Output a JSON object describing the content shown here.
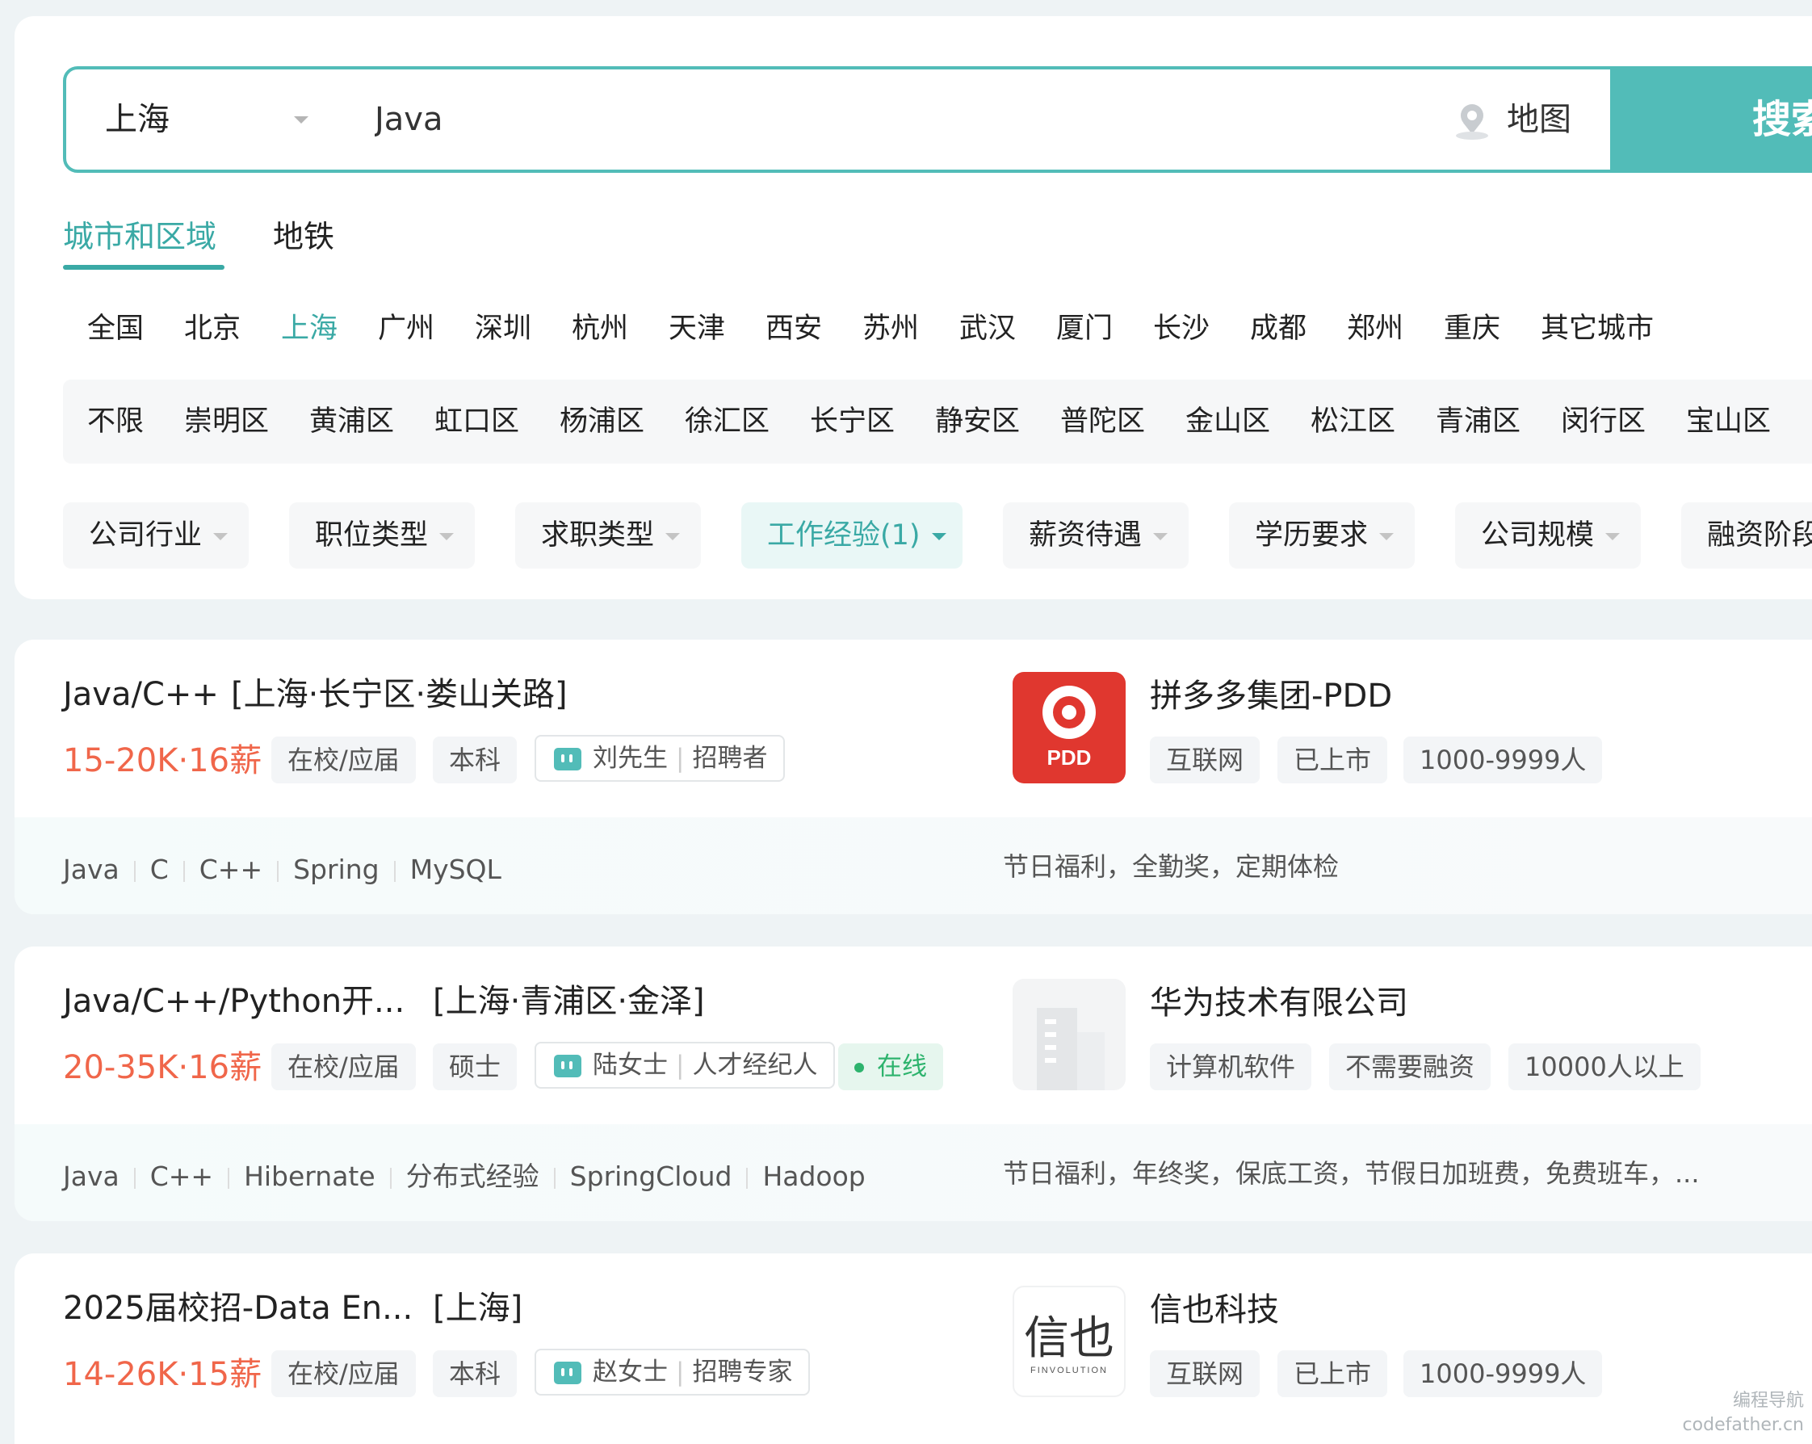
{
  "search": {
    "city": "上海",
    "keyword": "Java",
    "map_label": "地图",
    "button_label": "搜索"
  },
  "region_tabs": [
    {
      "label": "城市和区域",
      "active": true
    },
    {
      "label": "地铁",
      "active": false
    }
  ],
  "cities": [
    "全国",
    "北京",
    "上海",
    "广州",
    "深圳",
    "杭州",
    "天津",
    "西安",
    "苏州",
    "武汉",
    "厦门",
    "长沙",
    "成都",
    "郑州",
    "重庆",
    "其它城市"
  ],
  "active_city": "上海",
  "districts": [
    "不限",
    "崇明区",
    "黄浦区",
    "虹口区",
    "杨浦区",
    "徐汇区",
    "长宁区",
    "静安区",
    "普陀区",
    "金山区",
    "松江区",
    "青浦区",
    "闵行区",
    "宝山区"
  ],
  "filters": [
    "公司行业",
    "职位类型",
    "求职类型",
    "工作经验(1)",
    "薪资待遇",
    "学历要求",
    "公司规模",
    "融资阶段"
  ],
  "active_filter": "工作经验(1)",
  "jobs": [
    {
      "title": "Java/C++",
      "location": "[上海·长宁区·娄山关路]",
      "salary": "15-20K·16薪",
      "tags": [
        "在校/应届",
        "本科"
      ],
      "recruiter_name": "刘先生",
      "recruiter_role": "招聘者",
      "online": "",
      "company": "拼多多集团-PDD",
      "company_logo_text": "PDD",
      "company_tags": [
        "互联网",
        "已上市",
        "1000-9999人"
      ],
      "skills": [
        "Java",
        "C",
        "C++",
        "Spring",
        "MySQL"
      ],
      "welfare": "节日福利，全勤奖，定期体检"
    },
    {
      "title": "Java/C++/Python开...",
      "location": "[上海·青浦区·金泽]",
      "salary": "20-35K·16薪",
      "tags": [
        "在校/应届",
        "硕士"
      ],
      "recruiter_name": "陆女士",
      "recruiter_role": "人才经纪人",
      "online": "在线",
      "company": "华为技术有限公司",
      "company_logo_text": "",
      "company_tags": [
        "计算机软件",
        "不需要融资",
        "10000人以上"
      ],
      "skills": [
        "Java",
        "C++",
        "Hibernate",
        "分布式经验",
        "SpringCloud",
        "Hadoop"
      ],
      "welfare": "节日福利，年终奖，保底工资，节假日加班费，免费班车，..."
    },
    {
      "title": "2025届校招-Data En...",
      "location": "[上海]",
      "salary": "14-26K·15薪",
      "tags": [
        "在校/应届",
        "本科"
      ],
      "recruiter_name": "赵女士",
      "recruiter_role": "招聘专家",
      "online": "",
      "company": "信也科技",
      "company_logo_text": "信也",
      "company_logo_sub": "FINVOLUTION",
      "company_tags": [
        "互联网",
        "已上市",
        "1000-9999人"
      ],
      "skills": [],
      "welfare": ""
    }
  ],
  "watermark": [
    "编程导航",
    "codefather.cn"
  ],
  "colors": {
    "accent": "#52bcb8",
    "accent_text": "#3aa9a5",
    "salary": "#f0664a",
    "online": "#2db36d",
    "pdd_red": "#e0372f"
  }
}
